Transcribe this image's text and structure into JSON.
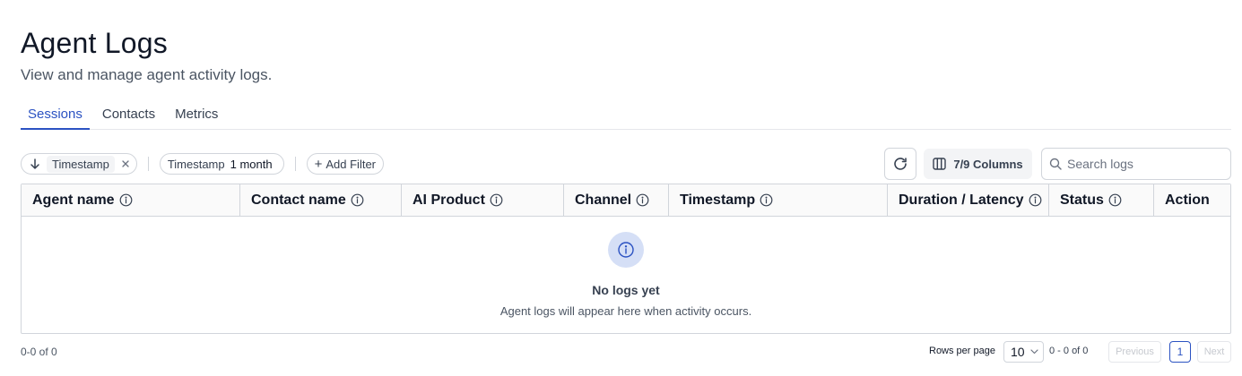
{
  "header": {
    "title": "Agent Logs",
    "subtitle": "View and manage agent activity logs."
  },
  "tabs": [
    {
      "label": "Sessions",
      "active": true
    },
    {
      "label": "Contacts",
      "active": false
    },
    {
      "label": "Metrics",
      "active": false
    }
  ],
  "filters": {
    "sort_label": "Timestamp",
    "range_label": "Timestamp",
    "range_value": "1 month",
    "add_label": "Add Filter"
  },
  "toolbar": {
    "columns_label": "7/9 Columns",
    "search_placeholder": "Search logs"
  },
  "table": {
    "columns": [
      "Agent name",
      "Contact name",
      "AI Product",
      "Channel",
      "Timestamp",
      "Duration / Latency",
      "Status",
      "Action"
    ],
    "rows": [],
    "empty_title": "No logs yet",
    "empty_description": "Agent logs will appear here when activity occurs."
  },
  "footer": {
    "summary": "0-0 of 0",
    "rows_per_page_label": "Rows per page",
    "rows_per_page": "10",
    "range": "0 - 0 of 0",
    "previous": "Previous",
    "page": "1",
    "next": "Next"
  },
  "colors": {
    "accent": "#2b52c2",
    "empty_icon_bg": "#d5dff6",
    "border": "#d1d5db"
  }
}
